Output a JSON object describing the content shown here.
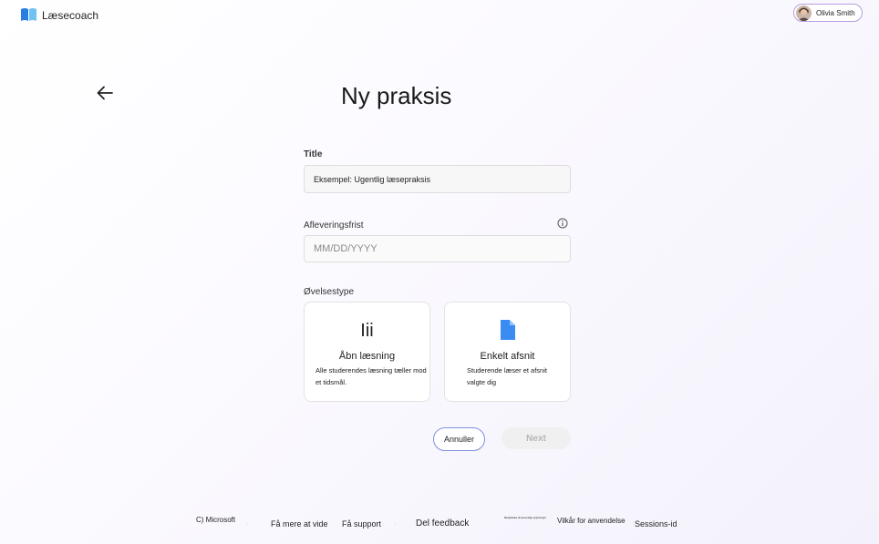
{
  "header": {
    "app_name": "Læsecoach",
    "user_name": "Olivia Smith"
  },
  "page": {
    "title": "Ny praksis"
  },
  "form": {
    "title_label": "Title",
    "title_value": "Eksempel: Ugentlig læsepraksis",
    "deadline_label": "Afleveringsfrist",
    "deadline_placeholder": "MM/DD/YYYY",
    "exercise_label": "Øvelsestype",
    "cards": [
      {
        "icon_text": "Iii",
        "title": "Åbn læsning",
        "description": "Alle studerendes læsning tæller mod et tidsmål."
      },
      {
        "title": "Enkelt afsnit",
        "description": "Studerende læser et afsnit valgte dig"
      }
    ],
    "cancel_label": "Annuller",
    "next_label": "Next"
  },
  "footer": {
    "copyright": "C) Microsoft",
    "learn_more": "Få mere at vide",
    "support": "Få support",
    "feedback": "Del feedback",
    "privacy": "Beskyttelse af personlige oplysninger",
    "terms": "Vilkår for anvendelse",
    "session": "Sessions-id"
  },
  "colors": {
    "accent_border": "#7f8fe0",
    "profile_border": "#b79de0",
    "doc_icon": "#3b8cf2",
    "logo_blue": "#2a7de1",
    "logo_light": "#6ec3f4"
  }
}
